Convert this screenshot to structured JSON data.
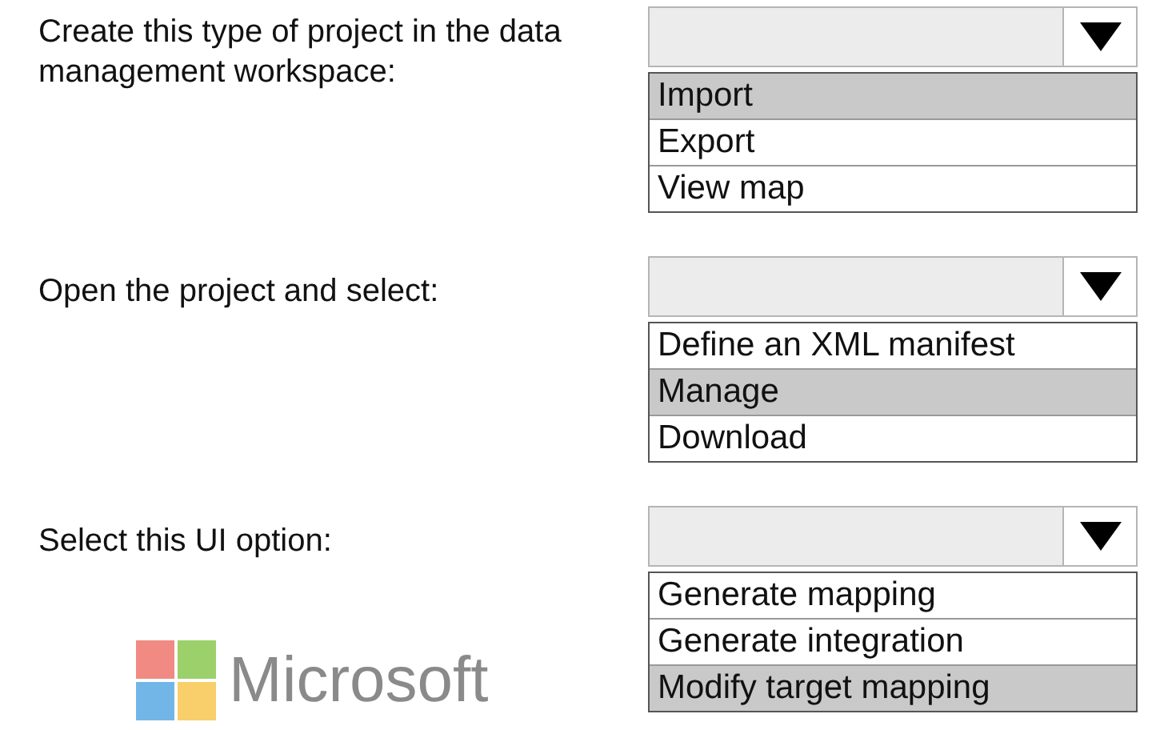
{
  "questions": [
    {
      "label": "Create this type of project in the data management workspace:",
      "options": [
        {
          "text": "Import",
          "selected": true
        },
        {
          "text": "Export",
          "selected": false
        },
        {
          "text": "View map",
          "selected": false
        }
      ]
    },
    {
      "label": "Open the project and select:",
      "options": [
        {
          "text": "Define an XML manifest",
          "selected": false
        },
        {
          "text": "Manage",
          "selected": true
        },
        {
          "text": "Download",
          "selected": false
        }
      ]
    },
    {
      "label": "Select this UI option:",
      "options": [
        {
          "text": "Generate mapping",
          "selected": false
        },
        {
          "text": "Generate integration",
          "selected": false
        },
        {
          "text": "Modify target mapping",
          "selected": true
        }
      ]
    }
  ],
  "logo": {
    "text": "Microsoft"
  }
}
